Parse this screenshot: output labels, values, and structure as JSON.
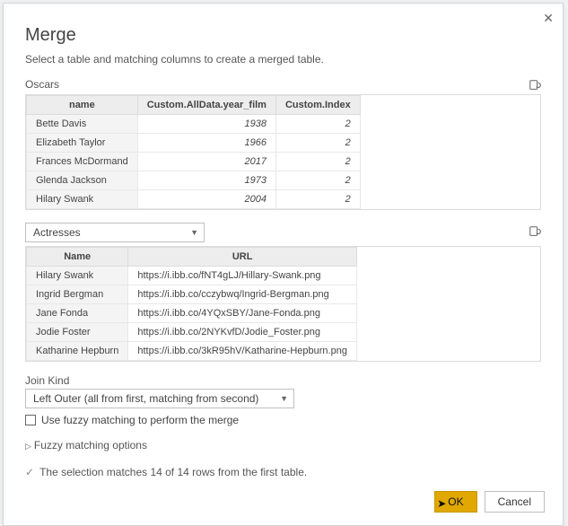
{
  "title": "Merge",
  "subtitle": "Select a table and matching columns to create a merged table.",
  "table1": {
    "name": "Oscars",
    "headers": [
      "name",
      "Custom.AllData.year_film",
      "Custom.Index"
    ],
    "rows": [
      {
        "c0": "Bette Davis",
        "c1": "1938",
        "c2": "2"
      },
      {
        "c0": "Elizabeth Taylor",
        "c1": "1966",
        "c2": "2"
      },
      {
        "c0": "Frances McDormand",
        "c1": "2017",
        "c2": "2"
      },
      {
        "c0": "Glenda Jackson",
        "c1": "1973",
        "c2": "2"
      },
      {
        "c0": "Hilary Swank",
        "c1": "2004",
        "c2": "2"
      }
    ]
  },
  "table2": {
    "dropdown_value": "Actresses",
    "headers": [
      "Name",
      "URL"
    ],
    "rows": [
      {
        "c0": "Hilary Swank",
        "c1": "https://i.ibb.co/fNT4gLJ/Hillary-Swank.png"
      },
      {
        "c0": "Ingrid Bergman",
        "c1": "https://i.ibb.co/cczybwq/Ingrid-Bergman.png"
      },
      {
        "c0": "Jane Fonda",
        "c1": "https://i.ibb.co/4YQxSBY/Jane-Fonda.png"
      },
      {
        "c0": "Jodie Foster",
        "c1": "https://i.ibb.co/2NYKvfD/Jodie_Foster.png"
      },
      {
        "c0": "Katharine Hepburn",
        "c1": "https://i.ibb.co/3kR95hV/Katharine-Hepburn.png"
      }
    ]
  },
  "join_kind": {
    "label": "Join Kind",
    "value": "Left Outer (all from first, matching from second)"
  },
  "fuzzy_checkbox_label": "Use fuzzy matching to perform the merge",
  "fuzzy_options_label": "Fuzzy matching options",
  "status_text": "The selection matches 14 of 14 rows from the first table.",
  "buttons": {
    "ok": "OK",
    "cancel": "Cancel"
  }
}
